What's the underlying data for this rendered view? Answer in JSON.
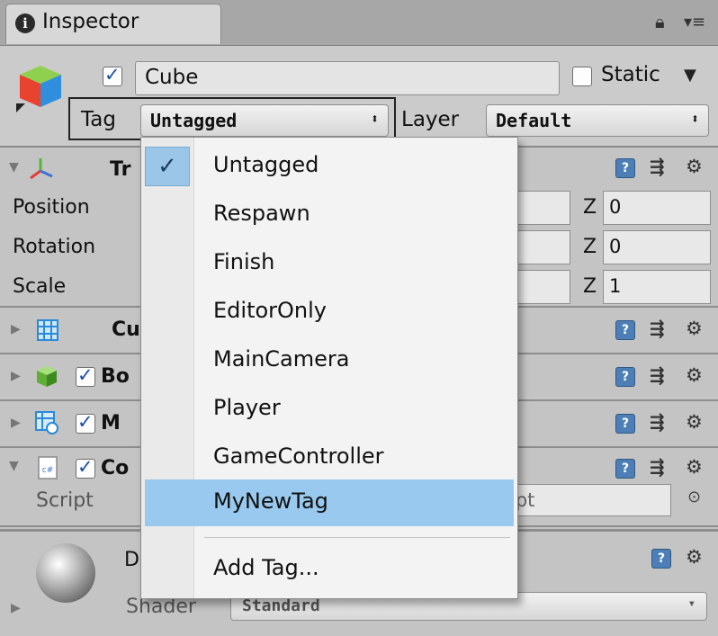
{
  "tab": {
    "title": "Inspector"
  },
  "object": {
    "name": "Cube",
    "active": true,
    "static_label": "Static",
    "static_checked": false,
    "tag_label": "Tag",
    "tag_value": "Untagged",
    "layer_label": "Layer",
    "layer_value": "Default"
  },
  "transform": {
    "title": "Tr",
    "rows": [
      {
        "label": "Position",
        "z_label": "Z",
        "z_value": "0"
      },
      {
        "label": "Rotation",
        "z_label": "Z",
        "z_value": "0"
      },
      {
        "label": "Scale",
        "z_label": "Z",
        "z_value": "1"
      }
    ]
  },
  "components": [
    {
      "title": "Cu"
    },
    {
      "title": "Bo"
    },
    {
      "title": "M"
    },
    {
      "title": "Co"
    }
  ],
  "script_row": {
    "label": "Script",
    "value_suffix": "ipt"
  },
  "material": {
    "title": "D",
    "shader_label": "Shader",
    "shader_value": "Standard"
  },
  "tag_menu": {
    "items": [
      "Untagged",
      "Respawn",
      "Finish",
      "EditorOnly",
      "MainCamera",
      "Player",
      "GameController",
      "MyNewTag"
    ],
    "checked_index": 0,
    "highlighted_index": 7,
    "add_label": "Add Tag..."
  },
  "colors": {
    "highlight": "#99c9ee",
    "panel": "#c4c4c4",
    "help_icon": "#4d7fb6"
  }
}
